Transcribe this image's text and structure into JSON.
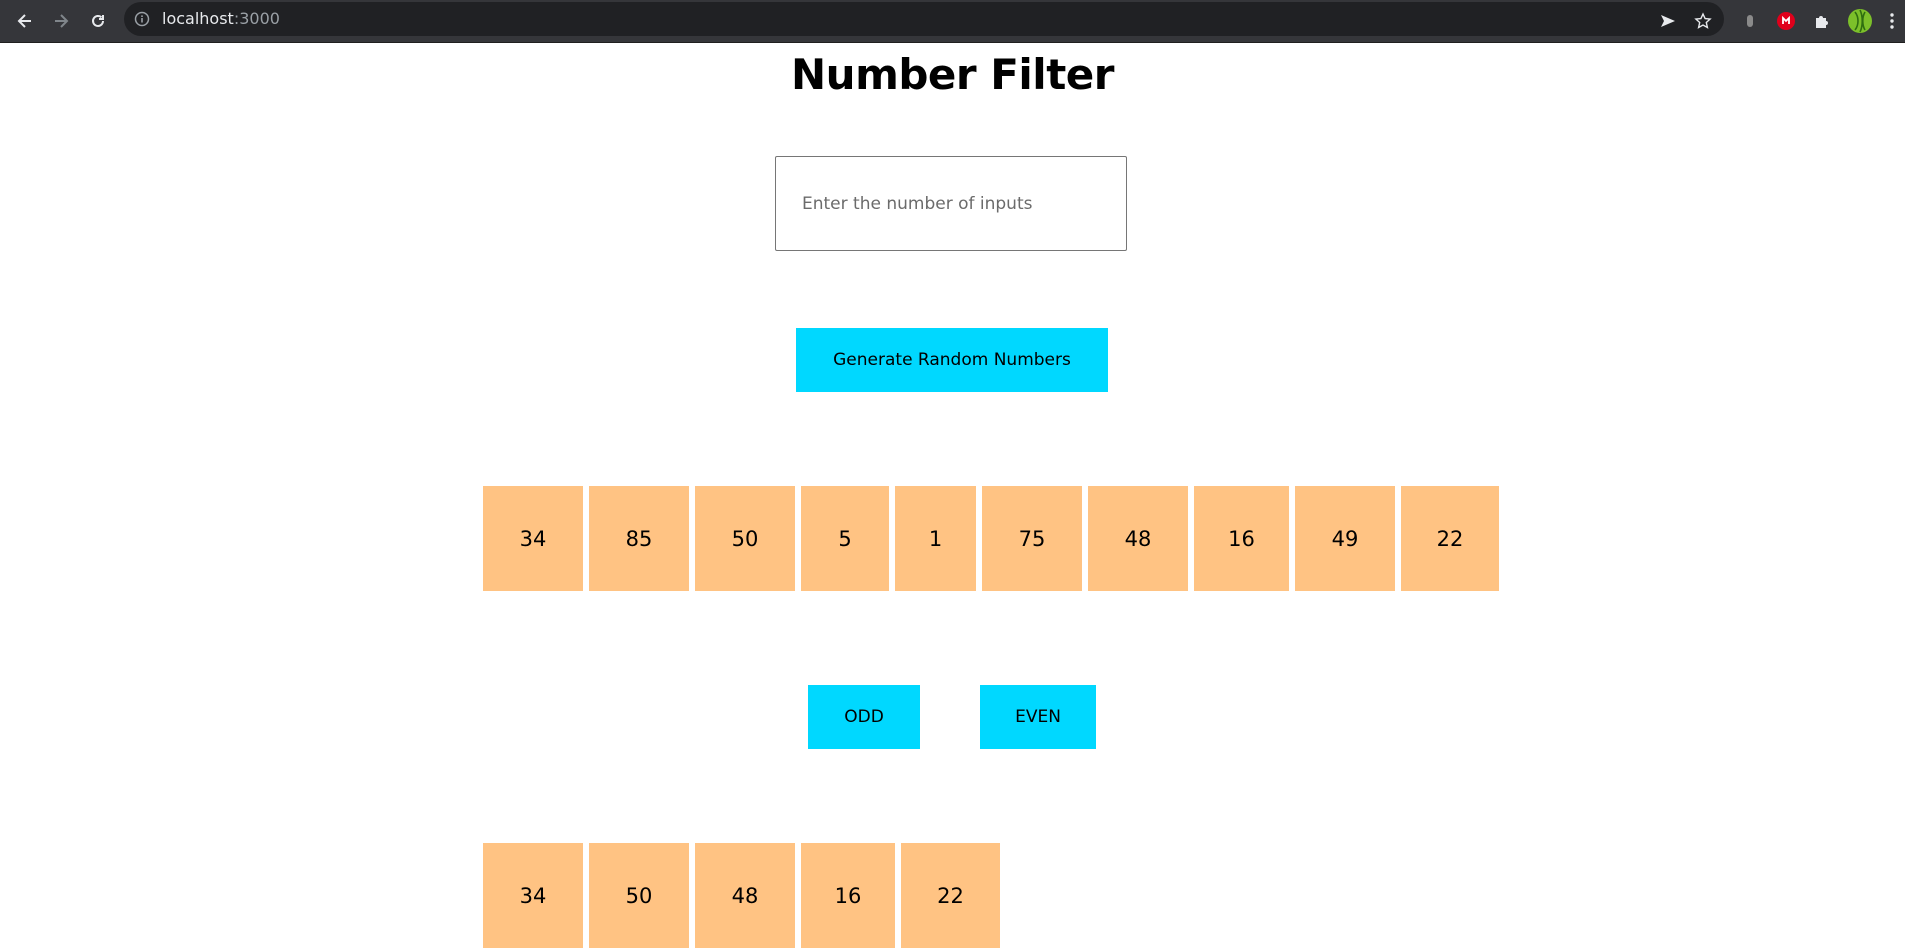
{
  "browser": {
    "url_host": "localhost",
    "url_port": ":3000"
  },
  "page": {
    "title": "Number Filter",
    "input_placeholder": "Enter the number of inputs",
    "generate_label": "Generate Random Numbers",
    "odd_label": "ODD",
    "even_label": "EVEN"
  },
  "numbers": [
    "34",
    "85",
    "50",
    "5",
    "1",
    "75",
    "48",
    "16",
    "49",
    "22"
  ],
  "filtered": [
    "34",
    "50",
    "48",
    "16",
    "22"
  ],
  "colors": {
    "accent": "#00d8ff",
    "cell": "#ffc383"
  }
}
